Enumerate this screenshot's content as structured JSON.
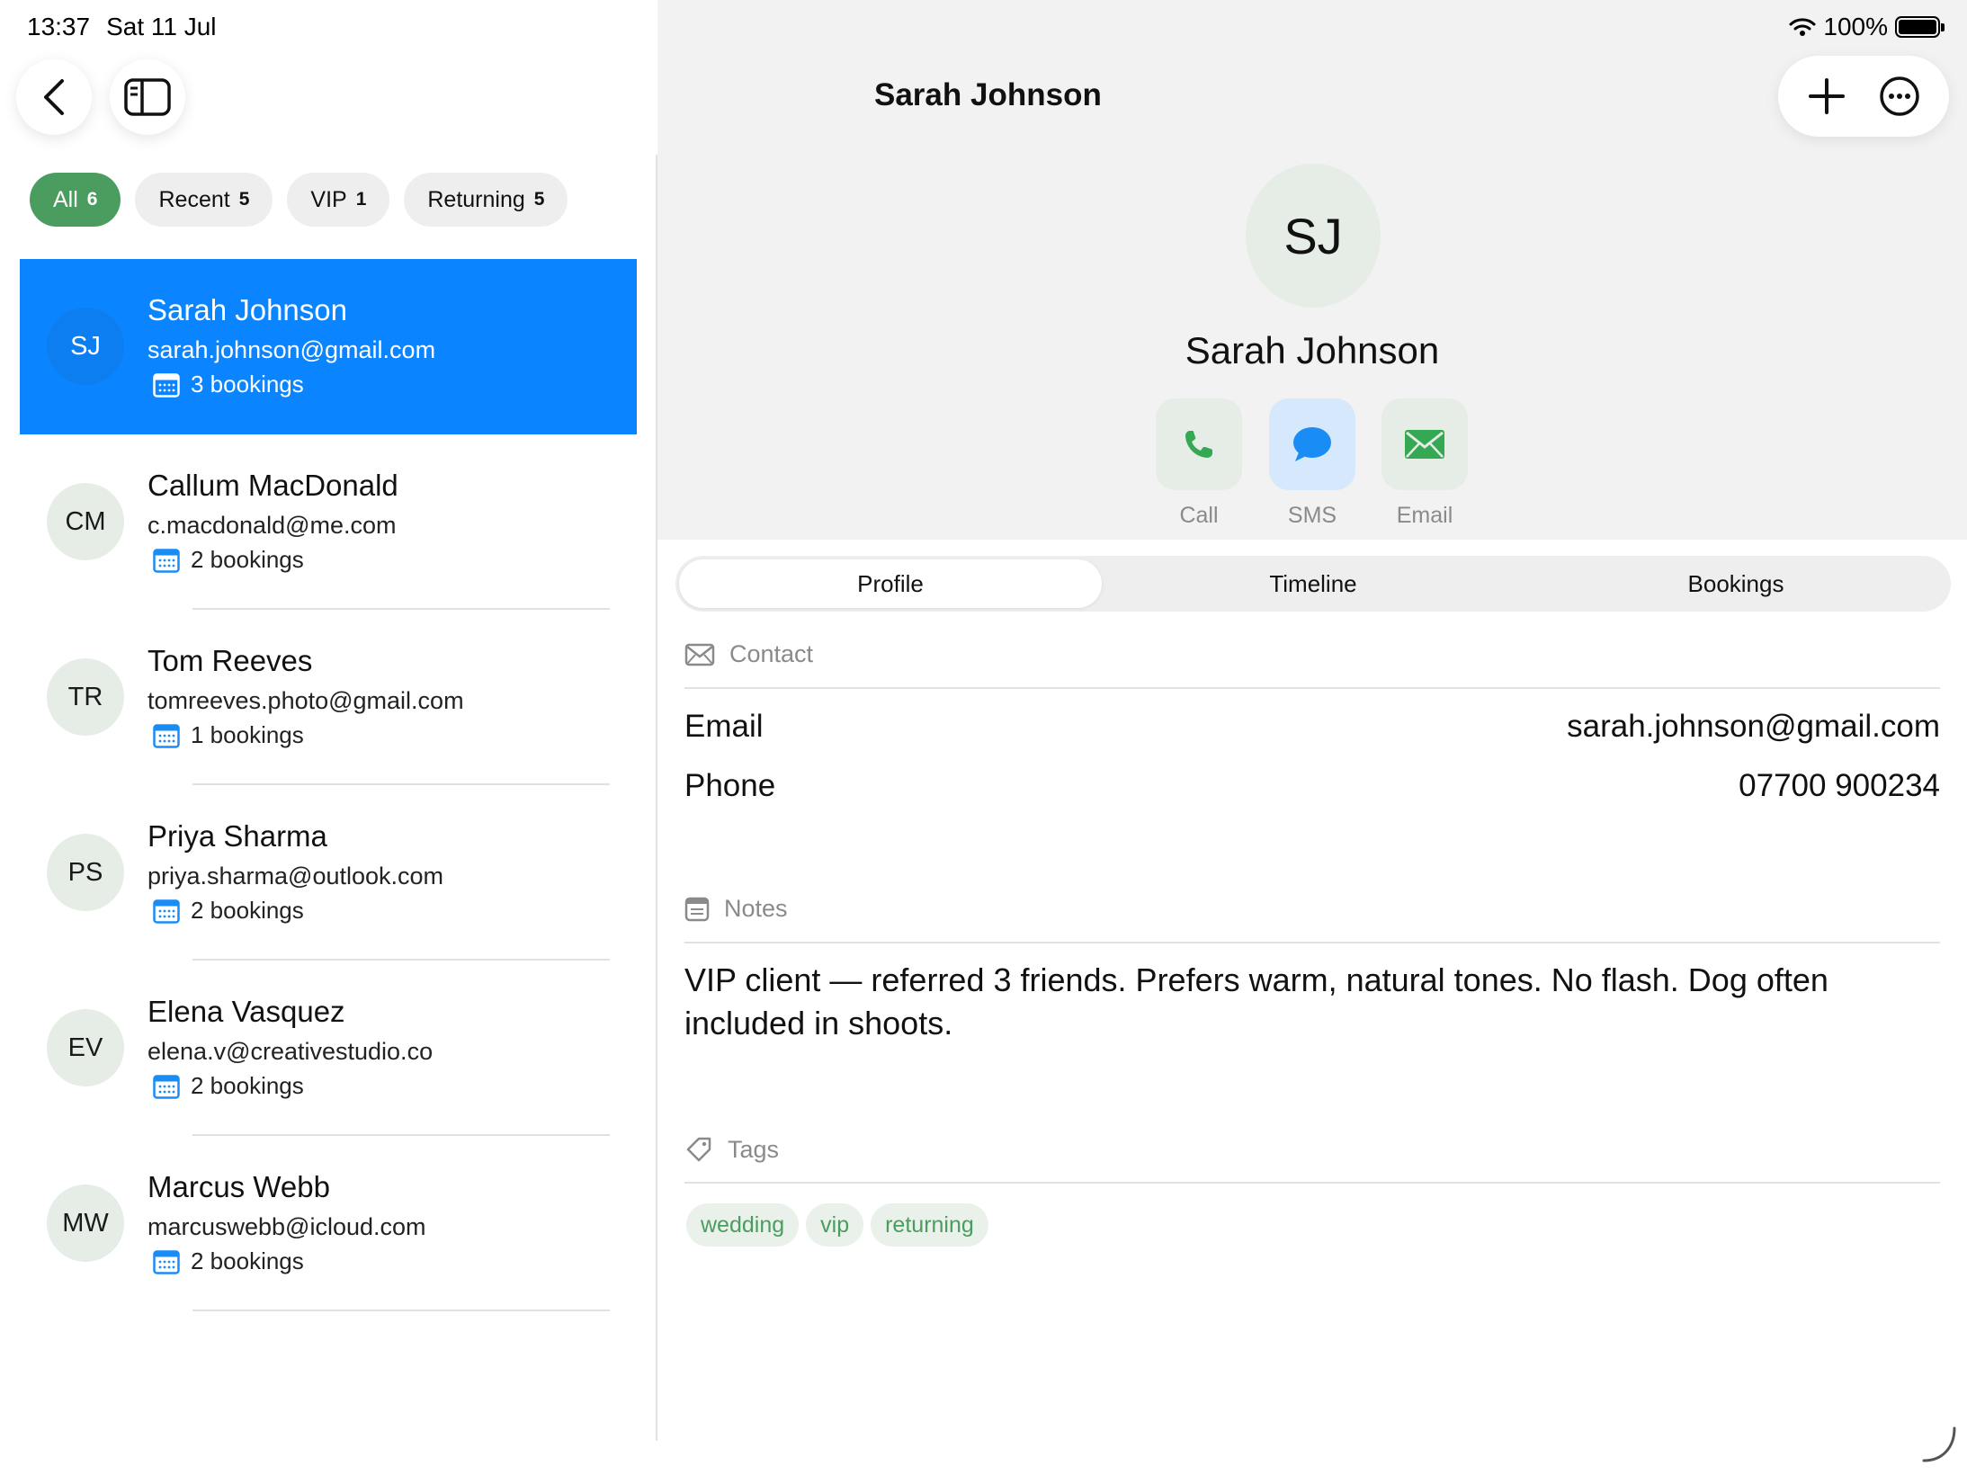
{
  "status_bar": {
    "time": "13:37",
    "date": "Sat 11 Jul",
    "battery": "100%"
  },
  "filters": [
    {
      "label": "All",
      "count": "6"
    },
    {
      "label": "Recent",
      "count": "5"
    },
    {
      "label": "VIP",
      "count": "1"
    },
    {
      "label": "Returning",
      "count": "5"
    }
  ],
  "clients": [
    {
      "initials": "SJ",
      "name": "Sarah Johnson",
      "email": "sarah.johnson@gmail.com",
      "bookings": "3 bookings"
    },
    {
      "initials": "CM",
      "name": "Callum MacDonald",
      "email": "c.macdonald@me.com",
      "bookings": "2 bookings"
    },
    {
      "initials": "TR",
      "name": "Tom Reeves",
      "email": "tomreeves.photo@gmail.com",
      "bookings": "1 bookings"
    },
    {
      "initials": "PS",
      "name": "Priya Sharma",
      "email": "priya.sharma@outlook.com",
      "bookings": "2 bookings"
    },
    {
      "initials": "EV",
      "name": "Elena Vasquez",
      "email": "elena.v@creativestudio.co",
      "bookings": "2 bookings"
    },
    {
      "initials": "MW",
      "name": "Marcus Webb",
      "email": "marcuswebb@icloud.com",
      "bookings": "2 bookings"
    }
  ],
  "detail": {
    "title": "Sarah Johnson",
    "initials": "SJ",
    "name": "Sarah Johnson",
    "actions": {
      "call": "Call",
      "sms": "SMS",
      "email": "Email"
    },
    "tabs": [
      "Profile",
      "Timeline",
      "Bookings"
    ],
    "contact": {
      "heading": "Contact",
      "email_label": "Email",
      "email_value": "sarah.johnson@gmail.com",
      "phone_label": "Phone",
      "phone_value": "07700 900234"
    },
    "notes": {
      "heading": "Notes",
      "text": "VIP client — referred 3 friends. Prefers warm, natural tones. No flash. Dog often included in shoots."
    },
    "tags": {
      "heading": "Tags",
      "items": [
        "wedding",
        "vip",
        "returning"
      ]
    }
  },
  "colors": {
    "accent_green": "#4a9d5f",
    "selected_blue": "#0a84ff",
    "sms_blue": "#1a8cf5"
  }
}
